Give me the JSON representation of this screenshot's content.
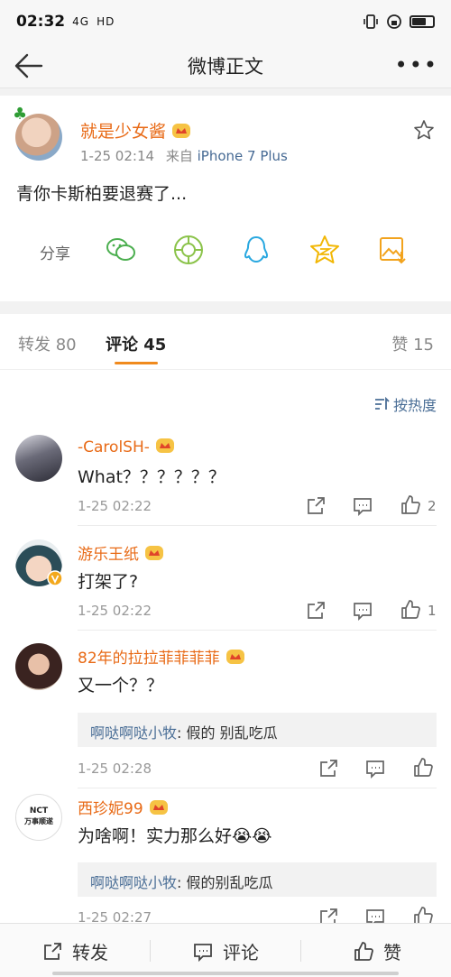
{
  "status_bar": {
    "time": "02:32",
    "signal": "4G",
    "wifi_label": "HD",
    "battery_level": 0.7
  },
  "nav": {
    "title": "微博正文"
  },
  "post": {
    "author": "就是少女酱",
    "time": "1-25 02:14",
    "source_prefix": "来自",
    "source": "iPhone 7 Plus",
    "text": "青你卡斯柏要退赛了...",
    "share_label": "分享",
    "share_icons": [
      "wechat-icon",
      "moments-icon",
      "qq-icon",
      "qzone-icon",
      "save-image-icon"
    ]
  },
  "tabs": {
    "repost": "转发 80",
    "comments": "评论 45",
    "likes": "赞 15",
    "active": "comments"
  },
  "sort_label": "按热度",
  "comments": [
    {
      "name": "-CarolSH-",
      "text": "What？？？？？？",
      "time": "1-25 02:22",
      "likes": "2"
    },
    {
      "name": "游乐王纸",
      "text": "打架了?",
      "time": "1-25 02:22",
      "likes": "1"
    },
    {
      "name": "82年的拉拉菲菲菲菲",
      "text": "又一个？？",
      "reply_name": "啊哒啊哒小牧",
      "reply_text": ": 假的 别乱吃瓜",
      "time": "1-25 02:28",
      "likes": ""
    },
    {
      "name": "西珍妮99",
      "text": "为啥啊！实力那么好😭😭",
      "reply_name": "啊哒啊哒小牧",
      "reply_text": ": 假的别乱吃瓜",
      "time": "1-25 02:27",
      "likes": "",
      "avatar_text_top": "NCT",
      "avatar_text_bottom": "万事顺遂"
    }
  ],
  "bottom_bar": {
    "repost": "转发",
    "comment": "评论",
    "like": "赞"
  },
  "colors": {
    "accent": "#f08a1d",
    "username": "#e86a16",
    "link": "#4a6e96"
  }
}
